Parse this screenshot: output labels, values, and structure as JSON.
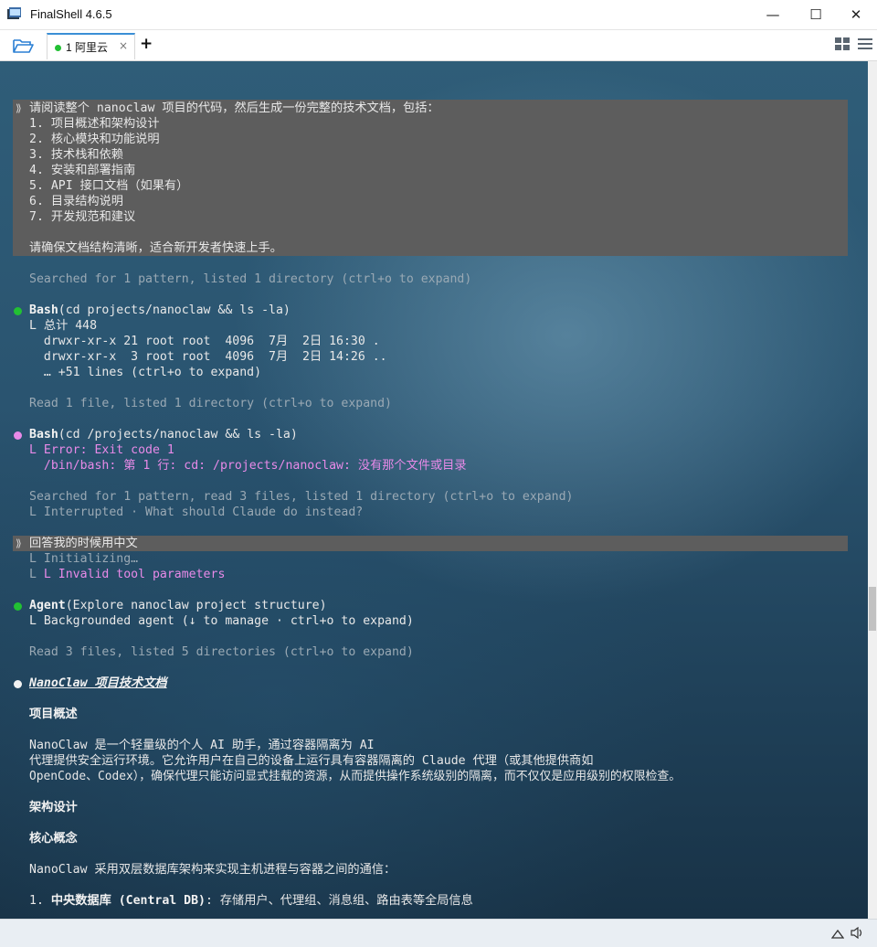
{
  "window": {
    "title": "FinalShell 4.6.5",
    "minimize": "—",
    "maximize": "☐",
    "close": "✕"
  },
  "tabs": [
    {
      "label": "1 阿里云",
      "status_color": "#22c033",
      "close": "×"
    }
  ],
  "tab_add": "+",
  "terminal": {
    "prompt1": {
      "chevron": "⟫",
      "lines": [
        "请阅读整个 nanoclaw 项目的代码，然后生成一份完整的技术文档，包括：",
        "1. 项目概述和架构设计",
        "2. 核心模块和功能说明",
        "3. 技术栈和依赖",
        "4. 安装和部署指南",
        "5. API 接口文档（如果有）",
        "6. 目录结构说明",
        "7. 开发规范和建议",
        "",
        "请确保文档结构清晰，适合新开发者快速上手。"
      ]
    },
    "search1": "Searched for 1 pattern, listed 1 directory (ctrl+o to expand)",
    "bash1": {
      "name": "Bash",
      "args": "(cd projects/nanoclaw && ls -la)",
      "output": [
        "L 总计 448",
        "  drwxr-xr-x 21 root root  4096  7月  2日 16:30 .",
        "  drwxr-xr-x  3 root root  4096  7月  2日 14:26 ..",
        "  … +51 lines (ctrl+o to expand)"
      ]
    },
    "read1": "Read 1 file, listed 1 directory (ctrl+o to expand)",
    "bash2": {
      "name": "Bash",
      "args": "(cd /projects/nanoclaw && ls -la)",
      "error": "L Error: Exit code 1",
      "error_detail": "  /bin/bash: 第 1 行: cd: /projects/nanoclaw: 没有那个文件或目录"
    },
    "search2": "Searched for 1 pattern, read 3 files, listed 1 directory (ctrl+o to expand)",
    "interrupted": "L Interrupted · What should Claude do instead?",
    "prompt2": {
      "chevron": "⟫",
      "text": "回答我的时候用中文",
      "initializing": "L Initializing…",
      "invalid": "L Invalid tool parameters"
    },
    "agent": {
      "name": "Agent",
      "args": "(Explore nanoclaw project structure)",
      "output": "L Backgrounded agent (↓ to manage · ctrl+o to expand)"
    },
    "read2": "Read 3 files, listed 5 directories (ctrl+o to expand)",
    "doc": {
      "title": "NanoClaw 项目技术文档",
      "h_overview": "项目概述",
      "overview": [
        "NanoClaw 是一个轻量级的个人 AI 助手，通过容器隔离为 AI",
        "代理提供安全运行环境。它允许用户在自己的设备上运行具有容器隔离的 Claude 代理（或其他提供商如",
        "OpenCode、Codex），确保代理只能访问显式挂载的资源，从而提供操作系统级别的隔离，而不仅仅是应用级别的权限检查。"
      ],
      "h_arch": "架构设计",
      "h_core": "核心概念",
      "core_text": "NanoClaw 采用双层数据库架构来实现主机进程与容器之间的通信：",
      "item1_prefix": "1. ",
      "item1_bold": "中央数据库 (Central DB)",
      "item1_rest": ": 存储用户、代理组、消息组、路由表等全局信息"
    }
  },
  "colors": {
    "success_dot": "#22c033",
    "error_dot": "#e88ae8",
    "prompt_bg": "#5d5d5d",
    "accent_tab": "#3b8fd6"
  },
  "statusbar": {
    "icons": [
      "keyboard-icon",
      "speaker-icon"
    ]
  }
}
